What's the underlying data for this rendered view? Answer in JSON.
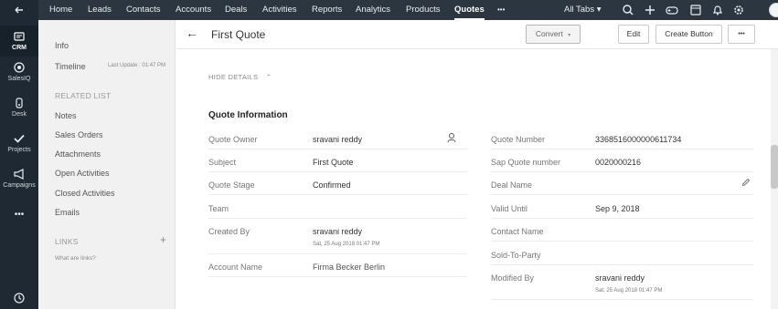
{
  "rail": {
    "items": [
      {
        "label": "CRM"
      },
      {
        "label": "SalesIQ"
      },
      {
        "label": "Desk"
      },
      {
        "label": "Projects"
      },
      {
        "label": "Campaigns"
      }
    ],
    "more": "•••"
  },
  "topnav": {
    "menu_icon": "☰",
    "items": [
      "Home",
      "Leads",
      "Contacts",
      "Accounts",
      "Deals",
      "Activities",
      "Reports",
      "Analytics",
      "Products",
      "Quotes"
    ],
    "more": "•••",
    "all_tabs": "All Tabs ▾",
    "active": "Quotes"
  },
  "sidebar": {
    "info": "Info",
    "timeline": "Timeline",
    "last_update": "Last Update : 01:47 PM",
    "related_list_heading": "RELATED LIST",
    "related": [
      "Notes",
      "Sales Orders",
      "Attachments",
      "Open Activities",
      "Closed Activities",
      "Emails"
    ],
    "links_heading": "LINKS",
    "links_add": "+",
    "what_are_links": "What are links?"
  },
  "header": {
    "back": "←",
    "title": "First Quote",
    "convert": "Convert",
    "convert_caret": "▾",
    "edit": "Edit",
    "create_button": "Create Button",
    "more": "•••"
  },
  "details": {
    "hide_details": "HIDE DETAILS",
    "hide_caret": "⌃",
    "section_title": "Quote Information",
    "left": [
      {
        "label": "Quote Owner",
        "value": "sravani reddy",
        "sub": ""
      },
      {
        "label": "Subject",
        "value": "First Quote",
        "sub": ""
      },
      {
        "label": "Quote Stage",
        "value": "Confirmed",
        "sub": ""
      },
      {
        "label": "Team",
        "value": "",
        "sub": ""
      },
      {
        "label": "Created By",
        "value": "sravani reddy",
        "sub": "Sat, 25 Aug 2018 01:47 PM"
      },
      {
        "label": "Account Name",
        "value": "Firma Becker Berlin",
        "sub": ""
      }
    ],
    "right": [
      {
        "label": "Quote Number",
        "value": "3368516000000611734",
        "sub": ""
      },
      {
        "label": "Sap Quote number",
        "value": "0020000216",
        "sub": ""
      },
      {
        "label": "Deal Name",
        "value": "",
        "sub": ""
      },
      {
        "label": "Valid Until",
        "value": "Sep 9, 2018",
        "sub": ""
      },
      {
        "label": "Contact Name",
        "value": "",
        "sub": ""
      },
      {
        "label": "Sold-To-Party",
        "value": "",
        "sub": ""
      },
      {
        "label": "Modified By",
        "value": "sravani reddy",
        "sub": "Sat, 25 Aug 2018 01:47 PM"
      }
    ]
  },
  "icons": {
    "owner_icon": "user-icon",
    "deal_edit_icon": "pencil-icon"
  }
}
